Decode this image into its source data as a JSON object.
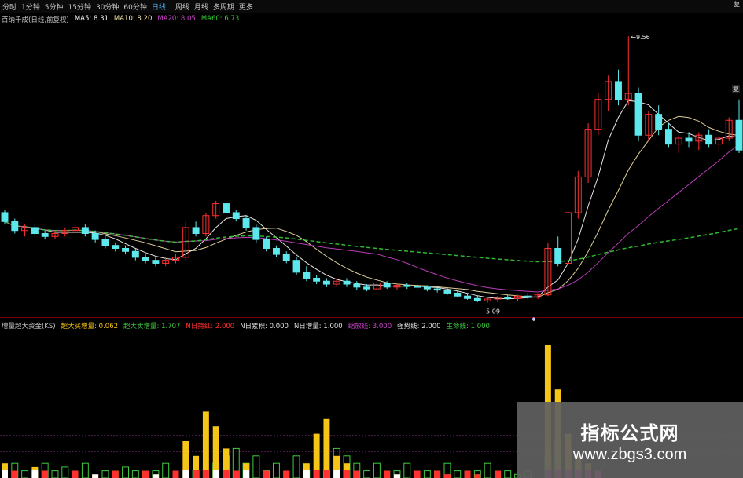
{
  "toolbar": {
    "tabs": [
      {
        "label": "分时",
        "active": false
      },
      {
        "label": "1分钟",
        "active": false
      },
      {
        "label": "5分钟",
        "active": false
      },
      {
        "label": "15分钟",
        "active": false
      },
      {
        "label": "30分钟",
        "active": false
      },
      {
        "label": "60分钟",
        "active": false
      },
      {
        "label": "日线",
        "active": true
      },
      {
        "label": "周线",
        "active": false
      },
      {
        "label": "月线",
        "active": false
      },
      {
        "label": "多周期",
        "active": false
      },
      {
        "label": "更多",
        "active": false
      }
    ],
    "corner_label": "复"
  },
  "main_legend": {
    "title": "百纳千成(日线,前复权)",
    "items": [
      {
        "label": "MA5: 8.31",
        "color": "#ffffff"
      },
      {
        "label": "MA10: 8.20",
        "color": "#f5e6a8"
      },
      {
        "label": "MA20: 8.05",
        "color": "#cc44cc"
      },
      {
        "label": "MA60: 6.73",
        "color": "#33cc33"
      }
    ]
  },
  "sub_legend": {
    "title": "增量超大资金(KS)",
    "items": [
      {
        "label": "超大买增量: 0.062",
        "color": "#f5c518"
      },
      {
        "label": "超大卖增量: 1.707",
        "color": "#3fcc3f"
      },
      {
        "label": "N日持红: 2.000",
        "color": "#ff3030"
      },
      {
        "label": "N日累积: 0.000",
        "color": "#e0e0e0"
      },
      {
        "label": "N日增量: 1.000",
        "color": "#e0e0e0"
      },
      {
        "label": "缩放线: 3.000",
        "color": "#cc44cc"
      },
      {
        "label": "强势线: 2.000",
        "color": "#e0e0e0"
      },
      {
        "label": "生命线: 1.000",
        "color": "#3fcc3f"
      }
    ]
  },
  "annotations": {
    "high_label": "9.56",
    "low_label": "5.09",
    "right_label": "复",
    "low_marker": "◆"
  },
  "watermark": {
    "title": "指标公式网",
    "url": "www.zbgs3.com"
  },
  "colors": {
    "up": "#ff3030",
    "down": "#5ce8ec",
    "ma5": "#ffffff",
    "ma10": "#f5e6a8",
    "ma20": "#cc44cc",
    "ma60": "#33cc33",
    "buy_bar": "#f5c518",
    "sell_bar": "#3fcc3f"
  },
  "chart_data": {
    "type": "candlestick",
    "ohlc": [
      [
        6.6,
        6.65,
        6.4,
        6.45
      ],
      [
        6.45,
        6.5,
        6.25,
        6.3
      ],
      [
        6.3,
        6.4,
        6.2,
        6.35
      ],
      [
        6.35,
        6.4,
        6.2,
        6.25
      ],
      [
        6.25,
        6.3,
        6.15,
        6.2
      ],
      [
        6.2,
        6.3,
        6.15,
        6.25
      ],
      [
        6.25,
        6.35,
        6.2,
        6.3
      ],
      [
        6.3,
        6.4,
        6.25,
        6.35
      ],
      [
        6.35,
        6.4,
        6.2,
        6.25
      ],
      [
        6.25,
        6.3,
        6.1,
        6.15
      ],
      [
        6.15,
        6.2,
        6.0,
        6.05
      ],
      [
        6.05,
        6.1,
        5.95,
        6.0
      ],
      [
        6.0,
        6.05,
        5.9,
        5.95
      ],
      [
        5.95,
        6.0,
        5.8,
        5.85
      ],
      [
        5.85,
        5.9,
        5.75,
        5.8
      ],
      [
        5.8,
        5.85,
        5.7,
        5.75
      ],
      [
        5.75,
        5.85,
        5.7,
        5.8
      ],
      [
        5.8,
        5.9,
        5.75,
        5.85
      ],
      [
        5.85,
        6.45,
        5.8,
        6.35
      ],
      [
        6.35,
        6.45,
        6.2,
        6.25
      ],
      [
        6.25,
        6.6,
        6.2,
        6.55
      ],
      [
        6.55,
        6.8,
        6.5,
        6.75
      ],
      [
        6.75,
        6.8,
        6.55,
        6.6
      ],
      [
        6.6,
        6.65,
        6.45,
        6.5
      ],
      [
        6.5,
        6.55,
        6.3,
        6.35
      ],
      [
        6.35,
        6.4,
        6.1,
        6.15
      ],
      [
        6.15,
        6.2,
        5.95,
        6.0
      ],
      [
        6.0,
        6.05,
        5.85,
        5.9
      ],
      [
        5.9,
        5.95,
        5.75,
        5.8
      ],
      [
        5.8,
        5.85,
        5.55,
        5.6
      ],
      [
        5.6,
        5.7,
        5.45,
        5.5
      ],
      [
        5.5,
        5.55,
        5.4,
        5.45
      ],
      [
        5.45,
        5.5,
        5.35,
        5.4
      ],
      [
        5.4,
        5.5,
        5.35,
        5.45
      ],
      [
        5.45,
        5.5,
        5.35,
        5.4
      ],
      [
        5.4,
        5.45,
        5.3,
        5.35
      ],
      [
        5.35,
        5.4,
        5.28,
        5.32
      ],
      [
        5.32,
        5.45,
        5.3,
        5.42
      ],
      [
        5.42,
        5.45,
        5.32,
        5.35
      ],
      [
        5.35,
        5.4,
        5.3,
        5.38
      ],
      [
        5.38,
        5.42,
        5.32,
        5.36
      ],
      [
        5.36,
        5.4,
        5.3,
        5.35
      ],
      [
        5.35,
        5.38,
        5.28,
        5.32
      ],
      [
        5.32,
        5.35,
        5.26,
        5.3
      ],
      [
        5.3,
        5.34,
        5.22,
        5.25
      ],
      [
        5.25,
        5.28,
        5.18,
        5.2
      ],
      [
        5.2,
        5.24,
        5.14,
        5.16
      ],
      [
        5.16,
        5.2,
        5.1,
        5.12
      ],
      [
        5.12,
        5.18,
        5.09,
        5.15
      ],
      [
        5.15,
        5.2,
        5.1,
        5.18
      ],
      [
        5.18,
        5.22,
        5.14,
        5.16
      ],
      [
        5.16,
        5.22,
        5.12,
        5.2
      ],
      [
        5.2,
        5.25,
        5.15,
        5.18
      ],
      [
        5.18,
        5.25,
        5.15,
        5.22
      ],
      [
        5.22,
        6.1,
        5.2,
        6.0
      ],
      [
        6.0,
        6.2,
        5.7,
        5.75
      ],
      [
        5.75,
        6.7,
        5.7,
        6.6
      ],
      [
        6.6,
        7.3,
        6.5,
        7.2
      ],
      [
        7.2,
        8.1,
        7.1,
        8.0
      ],
      [
        8.0,
        8.6,
        7.9,
        8.5
      ],
      [
        8.5,
        8.9,
        8.3,
        8.8
      ],
      [
        8.8,
        9.0,
        8.4,
        8.5
      ],
      [
        8.5,
        9.56,
        8.4,
        8.6
      ],
      [
        8.6,
        8.7,
        7.8,
        7.9
      ],
      [
        7.9,
        8.3,
        7.8,
        8.25
      ],
      [
        8.25,
        8.4,
        7.9,
        8.0
      ],
      [
        8.0,
        8.1,
        7.7,
        7.75
      ],
      [
        7.75,
        7.9,
        7.6,
        7.85
      ],
      [
        7.85,
        7.95,
        7.7,
        7.8
      ],
      [
        7.8,
        7.95,
        7.65,
        7.9
      ],
      [
        7.9,
        8.0,
        7.7,
        7.75
      ],
      [
        7.75,
        7.9,
        7.6,
        7.85
      ],
      [
        7.85,
        8.2,
        7.8,
        8.15
      ],
      [
        8.15,
        8.5,
        7.6,
        7.65
      ]
    ],
    "ylim": [
      4.9,
      9.8
    ],
    "volume_buy": [
      0.2,
      0.1,
      0,
      0.15,
      0.1,
      0,
      0,
      0.1,
      0,
      0.05,
      0,
      0.1,
      0,
      0,
      0.1,
      0.05,
      0,
      0.1,
      0.5,
      0.3,
      0.9,
      0.7,
      0.4,
      0.1,
      0.2,
      0,
      0.1,
      0,
      0.1,
      0,
      0.2,
      0.6,
      0.8,
      0.3,
      0.2,
      0.1,
      0,
      0,
      0.1,
      0.05,
      0,
      0.1,
      0,
      0.1,
      0.05,
      0,
      0.1,
      0.05,
      0,
      0.1,
      0,
      0,
      0,
      0,
      1.8,
      1.2,
      0.6,
      0.3,
      0.2,
      0.1,
      0,
      0,
      0,
      0,
      0,
      0,
      0,
      0,
      0,
      0,
      0,
      0,
      0,
      0
    ],
    "volume_sell": [
      0,
      0.2,
      0.1,
      0,
      0.2,
      0.1,
      0.15,
      0,
      0.2,
      0,
      0.1,
      0,
      0.15,
      0.1,
      0,
      0.1,
      0.2,
      0,
      0,
      0.1,
      0,
      0.2,
      0.3,
      0.4,
      0.2,
      0.3,
      0.1,
      0.2,
      0,
      0.3,
      0.1,
      0,
      0.1,
      0.4,
      0.3,
      0.2,
      0.1,
      0.2,
      0,
      0.1,
      0.2,
      0,
      0.1,
      0,
      0.2,
      0.1,
      0,
      0.1,
      0.2,
      0,
      0.1,
      0.05,
      0.1,
      0,
      0.3,
      0.5,
      0.4,
      0.2,
      0,
      0,
      0,
      0,
      0,
      0,
      0,
      0,
      0,
      0,
      0,
      0,
      0,
      0,
      0,
      0
    ]
  }
}
